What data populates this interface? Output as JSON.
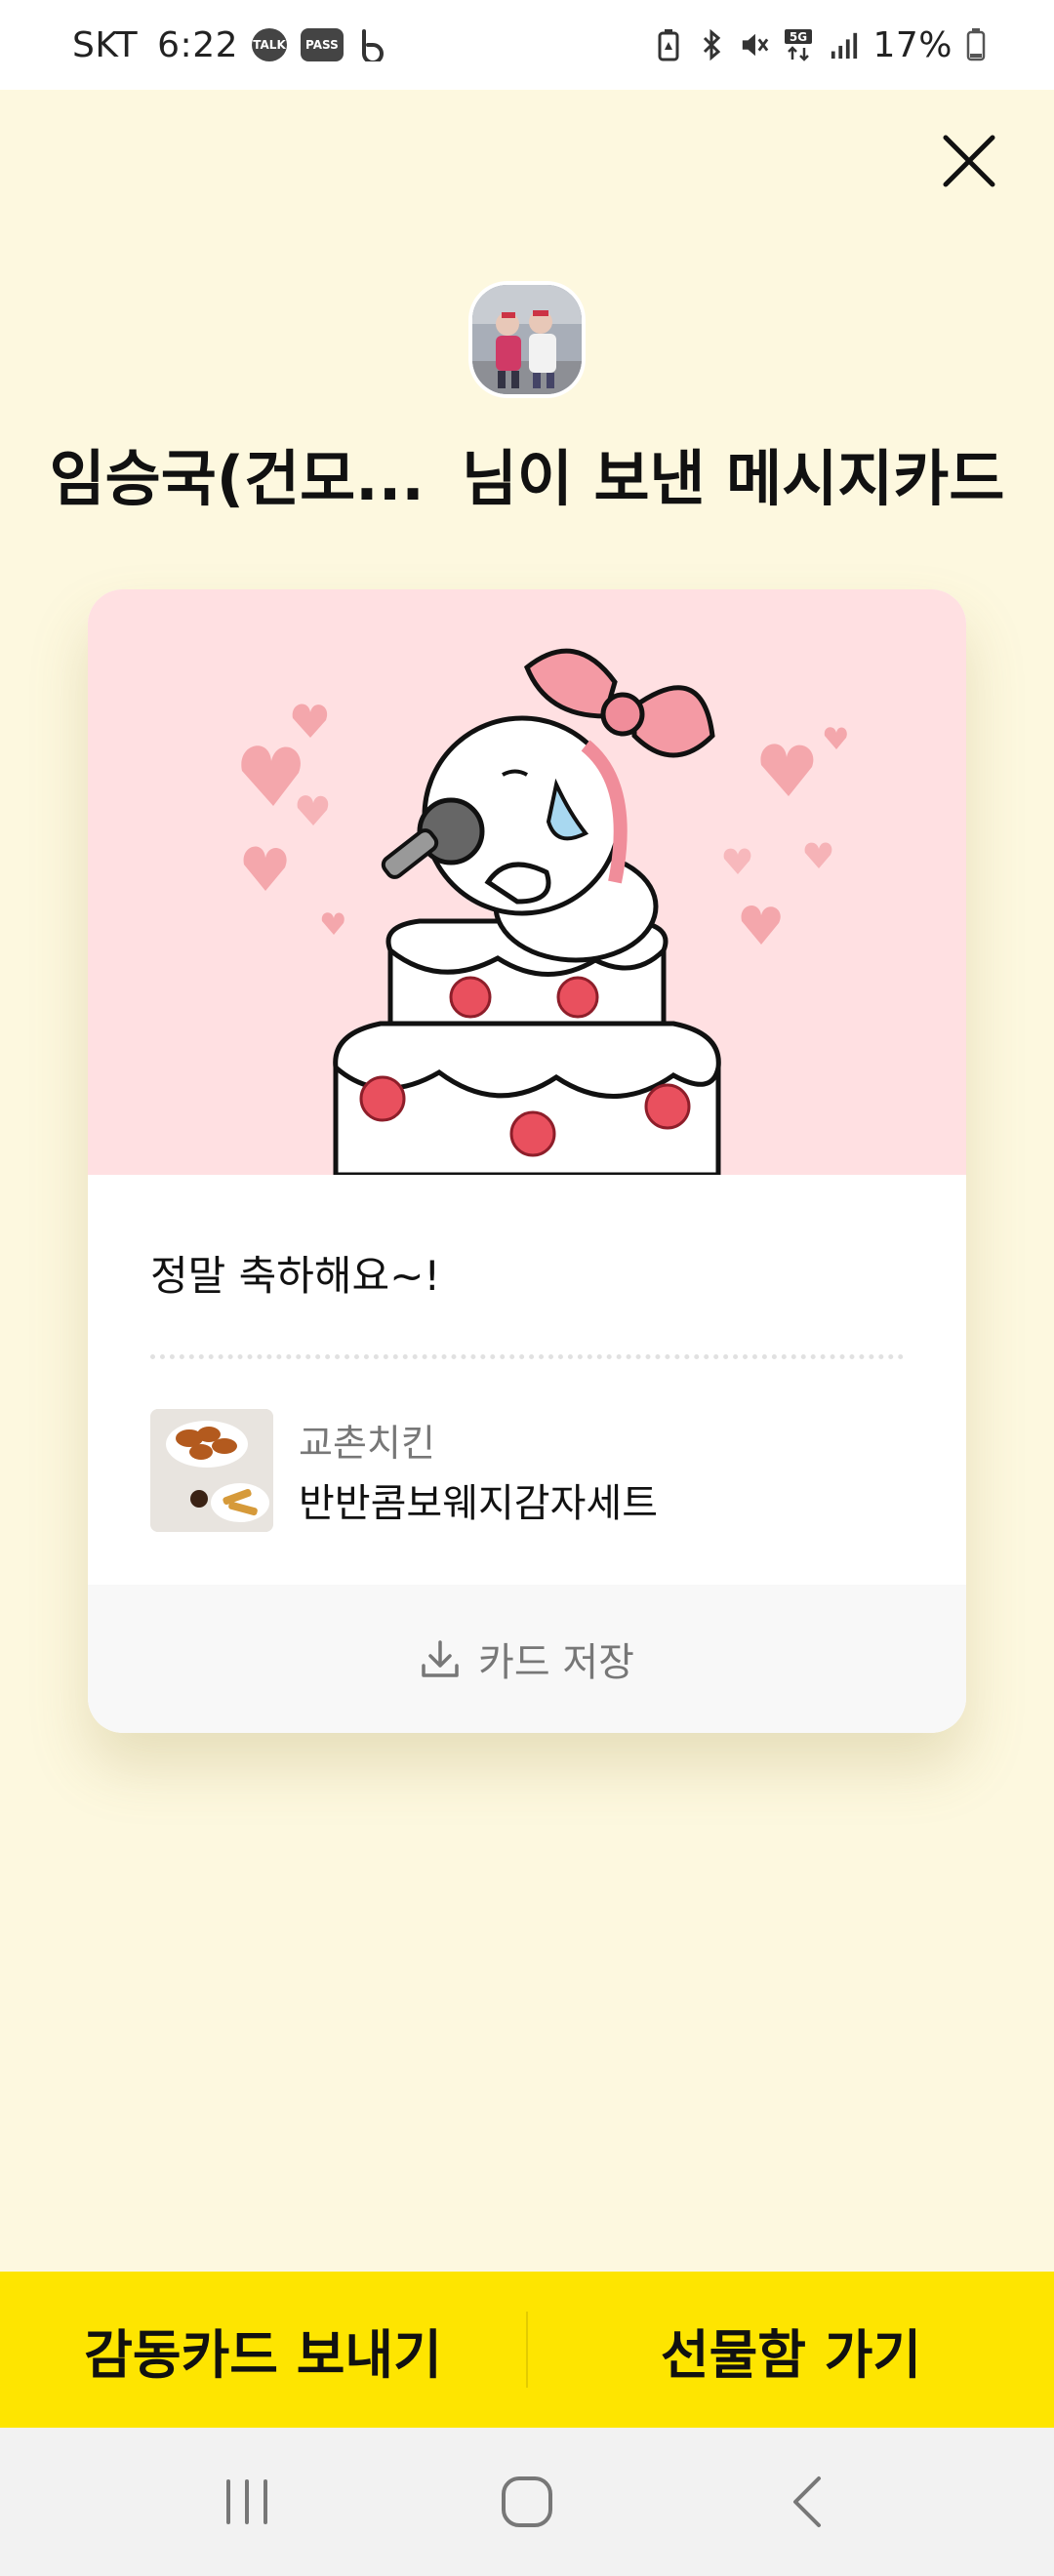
{
  "status_bar": {
    "carrier": "SKT",
    "time": "6:22",
    "notifications": [
      "talk-icon",
      "pass-icon",
      "b-icon"
    ],
    "battery": "17%",
    "network": "5G"
  },
  "header": {
    "sender": "임승국(건모...",
    "title_suffix": "님이 보낸 메시지카드"
  },
  "card": {
    "message": "정말 축하해요~!",
    "product": {
      "brand": "교촌치킨",
      "name": "반반콤보웨지감자세트"
    },
    "save_label": "카드 저장"
  },
  "actions": {
    "send_card": "감동카드 보내기",
    "gift_box": "선물함 가기"
  },
  "colors": {
    "background": "#fdf8df",
    "accent": "#fee500",
    "card_art_bg": "#ffe0e2"
  }
}
